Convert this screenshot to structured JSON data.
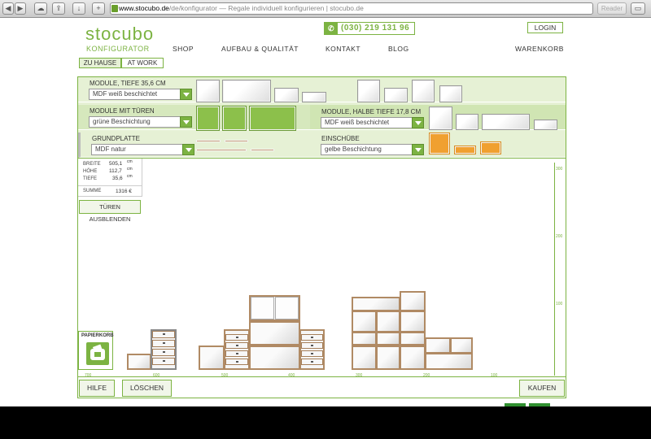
{
  "browser": {
    "url_domain": "www.stocubo.de",
    "url_path": "/de/konfigurator",
    "url_title": " — Regale individuell konfigurieren | stocubo.de",
    "reader": "Reader",
    "back": "◀",
    "fwd": "▶",
    "plus": "+"
  },
  "header": {
    "logo": "stocubo",
    "logo_sub": "KONFIGURATOR",
    "phone": "(030) 219 131 96",
    "login": "LOGIN",
    "nav": [
      "SHOP",
      "AUFBAU & QUALITÄT",
      "KONTAKT",
      "BLOG",
      "WARENKORB"
    ],
    "tabs": [
      "ZU HAUSE",
      "AT WORK"
    ]
  },
  "panel": {
    "g1_label": "MODULE, TIEFE 35,6 CM",
    "g1_value": "MDF weiß beschichtet",
    "g2_label": "MODULE MIT TÜREN",
    "g2_value": "grüne Beschichtung",
    "g3_label": "GRUNDPLATTE",
    "g3_value": "MDF natur",
    "g4_label": "MODULE, HALBE TIEFE 17,8 CM",
    "g4_value": "MDF weiß beschichtet",
    "g5_label": "EINSCHÜBE",
    "g5_value": "gelbe Beschichtung"
  },
  "info": {
    "breite_label": "BREITE",
    "breite": "505,1",
    "hoehe_label": "HÖHE",
    "hoehe": "112,7",
    "tiefe_label": "TIEFE",
    "tiefe": "35,6",
    "unit": "cm",
    "summe_label": "SUMME",
    "summe": "1316 €"
  },
  "buttons": {
    "doors": "TÜREN AUSBLENDEN",
    "help": "HILFE",
    "clear": "LÖSCHEN",
    "buy": "KAUFEN",
    "trash": "PAPIERKORB"
  },
  "ruler": {
    "x": [
      "700",
      "600",
      "500",
      "400",
      "300",
      "200",
      "100"
    ],
    "y": [
      "300",
      "200",
      "100"
    ]
  },
  "colors": {
    "accent": "#7cb342",
    "door": "#8cc04b",
    "insert": "#f0a030",
    "edge": "#b08a64"
  }
}
